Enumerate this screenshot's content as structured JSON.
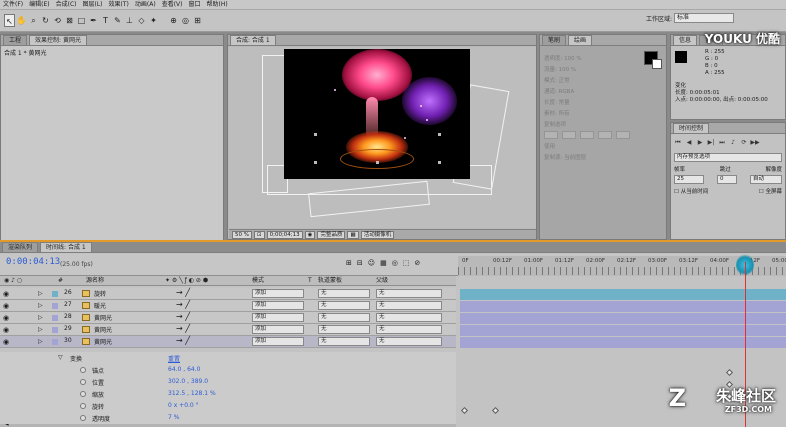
{
  "menu": [
    "文件(F)",
    "编辑(E)",
    "合成(C)",
    "图层(L)",
    "效果(T)",
    "动画(A)",
    "查看(V)",
    "窗口",
    "帮助(H)"
  ],
  "workspace": {
    "label": "工作区域:",
    "value": "标准"
  },
  "project": {
    "tabs": [
      "工程",
      "效果控制: 黄网光"
    ],
    "line": "合成 1 * 黄网光"
  },
  "viewer": {
    "tabs": [
      "合成: 合成 1"
    ],
    "zoom": "50 %",
    "time": "0;00;04;13",
    "quality": "完整品质",
    "camera": "活动摄像机"
  },
  "paint": {
    "tabs": [
      "笔刷",
      "绘画"
    ],
    "rows": [
      "透明度: 100 %",
      "流量: 100 %",
      "模式: 正常",
      "通道: RGBA",
      "长度: 常量",
      "素材: 所有",
      "复制选项",
      "使用",
      "复制源: 当前图层"
    ]
  },
  "info": {
    "tabs": [
      "信息",
      "音频"
    ],
    "rgb": [
      "R : 255",
      "G : 0",
      "B : 0",
      "A : 255"
    ],
    "extra": [
      "变化",
      "长度: 0:00:05:01",
      "入点: 0:00:00:00, 出点: 0:00:05:00"
    ]
  },
  "preview": {
    "tabs": [
      "时间控制"
    ],
    "ram": "内存预览选项",
    "fps_label": "帧率",
    "skip_label": "跳过",
    "res_label": "解像度",
    "fps": "25",
    "skip": "0",
    "res": "自动",
    "from_current": "从当前时间",
    "fullscreen": "全屏幕"
  },
  "timeline": {
    "tabs": [
      "渲染队列",
      "时间线: 合成 1"
    ],
    "timecode": "0:00:04:13",
    "fps": "(25.00 fps)",
    "columns": [
      "#",
      "源名称",
      "模式",
      "T",
      "轨道蒙板",
      "父级"
    ],
    "layers": [
      {
        "num": "26",
        "name": "旋转",
        "mode": "添加",
        "track": "无",
        "parent": "无",
        "color": "#6fb1c6"
      },
      {
        "num": "27",
        "name": "暖光",
        "mode": "添加",
        "track": "无",
        "parent": "无",
        "color": "#a3a3d4"
      },
      {
        "num": "28",
        "name": "黄网光",
        "mode": "添加",
        "track": "无",
        "parent": "无",
        "color": "#a3a3d4"
      },
      {
        "num": "29",
        "name": "黄网光",
        "mode": "添加",
        "track": "无",
        "parent": "无",
        "color": "#a3a3d4"
      },
      {
        "num": "30",
        "name": "黄网光",
        "mode": "添加",
        "track": "无",
        "parent": "无",
        "color": "#a3a3d4"
      }
    ],
    "transform": {
      "label": "变换",
      "reset": "重置"
    },
    "props": [
      {
        "name": "锚点",
        "value": "64.0 , 64.0"
      },
      {
        "name": "位置",
        "value": "302.0 , 389.0"
      },
      {
        "name": "缩放",
        "value": "312.5 , 128.1 %"
      },
      {
        "name": "旋转",
        "value": "0 x +0.0 °"
      },
      {
        "name": "透明度",
        "value": "7 %"
      }
    ],
    "ticks": [
      "0F",
      "00:12F",
      "01:00F",
      "01:12F",
      "02:00F",
      "02:12F",
      "03:00F",
      "03:12F",
      "04:00F",
      "04:12F",
      "05:00F"
    ]
  },
  "watermark": {
    "youku": "YOUKU 优酷",
    "zf": "朱峰社区",
    "zfsub": "ZF3D.COM"
  }
}
